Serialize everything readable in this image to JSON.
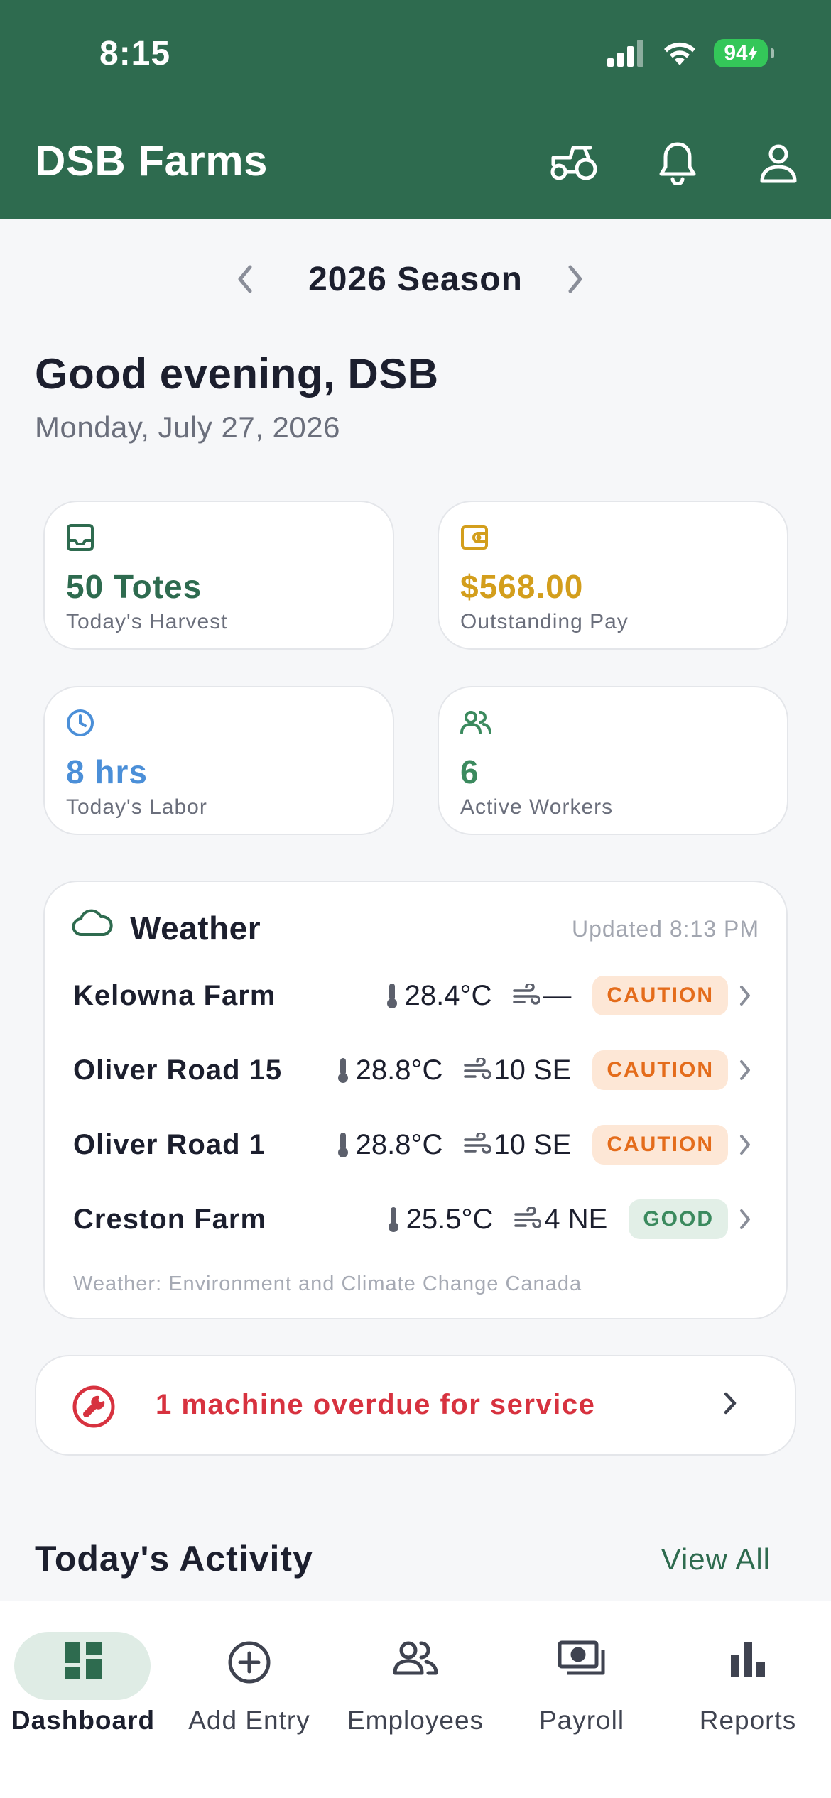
{
  "status_bar": {
    "time": "8:15",
    "battery": "94"
  },
  "header": {
    "title": "DSB Farms",
    "icons": [
      "tractor-icon",
      "bell-icon",
      "profile-icon"
    ],
    "background": "#2e6b4f"
  },
  "season": {
    "label": "2026 Season"
  },
  "greeting": {
    "text": "Good evening, DSB",
    "date": "Monday, July 27, 2026"
  },
  "stats": [
    {
      "value": "50 Totes",
      "label": "Today's Harvest",
      "icon": "inbox-tray-icon",
      "color": "#2e6b4f"
    },
    {
      "value": "$568.00",
      "label": "Outstanding Pay",
      "icon": "wallet-icon",
      "color": "#d39e1c"
    },
    {
      "value": "8 hrs",
      "label": "Today's Labor",
      "icon": "clock-icon",
      "color": "#4b8fd8"
    },
    {
      "value": "6",
      "label": "Active Workers",
      "icon": "users-icon",
      "color": "#3b8a5e"
    }
  ],
  "weather": {
    "title": "Weather",
    "updated": "Updated 8:13 PM",
    "rows": [
      {
        "name": "Kelowna Farm",
        "temp": "28.4°C",
        "wind": "—",
        "status": "CAUTION"
      },
      {
        "name": "Oliver Road 15",
        "temp": "28.8°C",
        "wind": "10 SE",
        "status": "CAUTION"
      },
      {
        "name": "Oliver Road 1",
        "temp": "28.8°C",
        "wind": "10 SE",
        "status": "CAUTION"
      },
      {
        "name": "Creston Farm",
        "temp": "25.5°C",
        "wind": "4 NE",
        "status": "GOOD"
      }
    ],
    "source": "Weather: Environment and Climate Change Canada"
  },
  "alert": {
    "text": "1 machine overdue for service",
    "color": "#d7323f"
  },
  "activity": {
    "title": "Today's Activity",
    "view_all": "View All"
  },
  "tabs": [
    {
      "label": "Dashboard",
      "icon": "dashboard-icon",
      "active": true
    },
    {
      "label": "Add Entry",
      "icon": "plus-circle-icon",
      "active": false
    },
    {
      "label": "Employees",
      "icon": "people-icon",
      "active": false
    },
    {
      "label": "Payroll",
      "icon": "money-icon",
      "active": false
    },
    {
      "label": "Reports",
      "icon": "bar-chart-icon",
      "active": false
    }
  ]
}
